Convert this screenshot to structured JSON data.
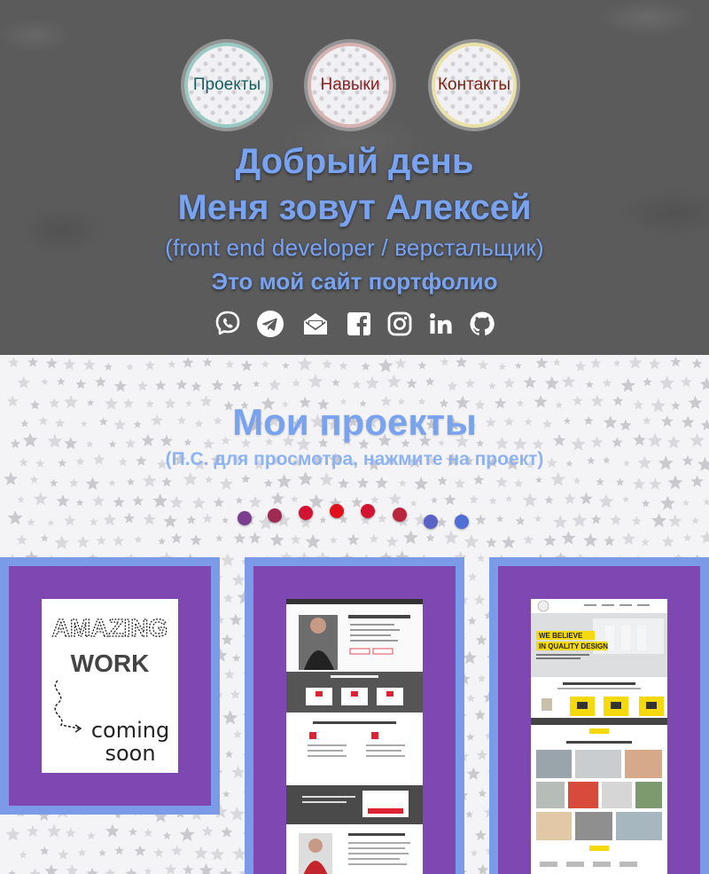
{
  "nav": {
    "projects": "Проекты",
    "skills": "Навыки",
    "contacts": "Контакты"
  },
  "hero": {
    "greeting": "Добрый день",
    "name_line": "Меня зовут Алексей",
    "role": "(front end developer / верстальщик)",
    "site": "Это мой сайт портфолио"
  },
  "socials": [
    "viber-icon",
    "telegram-icon",
    "mail-icon",
    "facebook-icon",
    "instagram-icon",
    "linkedin-icon",
    "github-icon"
  ],
  "projects": {
    "title": "Мои проекты",
    "subtitle": "(П.С. для просмотра, нажмите на проект)",
    "dot_colors": [
      "#7a3d8f",
      "#a02a52",
      "#d21432",
      "#e0101e",
      "#d21432",
      "#b8263e",
      "#5a63c4",
      "#4f6fd6"
    ],
    "cards": [
      {
        "preview": "AMAZING WORK coming soon",
        "line1": "AMAZING",
        "line2": "WORK",
        "line3": "coming",
        "line4": "soon"
      },
      {
        "preview": "landing-page-screenshot"
      },
      {
        "preview": "quality-design-screenshot",
        "banner1": "WE BELIEVE",
        "banner2": "IN QUALITY DESIGN"
      }
    ]
  },
  "colors": {
    "accent": "#7aa3ef",
    "card_border": "#7b9be8",
    "card_bg": "#7e47b2",
    "hero_bg": "#5b5b5b"
  }
}
